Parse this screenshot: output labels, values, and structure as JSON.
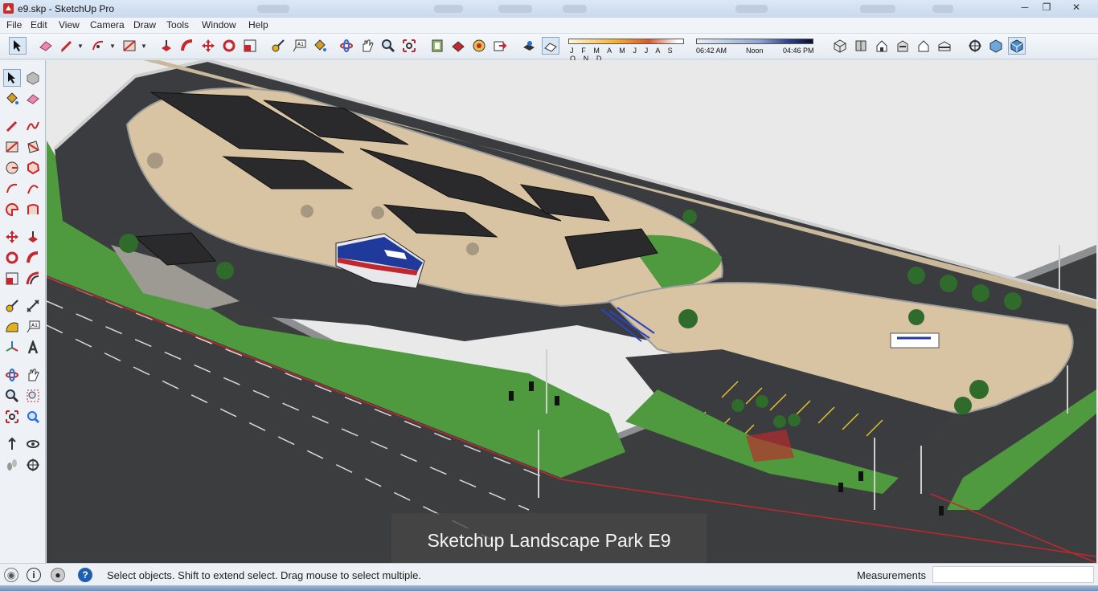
{
  "window": {
    "title": "e9.skp - SketchUp Pro",
    "controls": {
      "minimize": "─",
      "maximize": "❐",
      "close": "✕"
    }
  },
  "menubar": {
    "items": [
      "File",
      "Edit",
      "View",
      "Camera",
      "Draw",
      "Tools",
      "Window",
      "Help"
    ]
  },
  "shadow": {
    "months": "J F M A M J J A S O N D",
    "time_start": "06:42 AM",
    "time_noon": "Noon",
    "time_end": "04:46 PM"
  },
  "overlay": {
    "caption": "Sketchup Landscape Park E9"
  },
  "statusbar": {
    "hint": "Select objects. Shift to extend select. Drag mouse to select multiple.",
    "measurements_label": "Measurements",
    "measurements_value": ""
  },
  "colors": {
    "asphalt": "#3f3f41",
    "grass": "#4f9a3e",
    "plaza": "#d8c4a2",
    "canopy": "#2a2a2c",
    "bus_blue": "#1f3a9a",
    "accent_red": "#c0282d"
  },
  "toolbar_icons": [
    "select-icon",
    "eraser-icon",
    "pencil-icon",
    "arc-icon",
    "rectangle-icon",
    "push-pull-icon",
    "follow-me-icon",
    "move-icon",
    "rotate-icon",
    "scale-icon",
    "tape-measure-icon",
    "text-icon",
    "paint-bucket-icon",
    "orbit-icon",
    "pan-icon",
    "zoom-icon",
    "zoom-extents-icon",
    "components-icon",
    "materials-icon",
    "styles-icon",
    "export-icon",
    "shadows-icon",
    "fog-icon",
    "iso-view-icon",
    "front-view-icon",
    "top-view-icon",
    "right-view-icon",
    "back-view-icon",
    "left-view-icon",
    "position-camera-icon",
    "walk-icon",
    "look-around-icon"
  ]
}
